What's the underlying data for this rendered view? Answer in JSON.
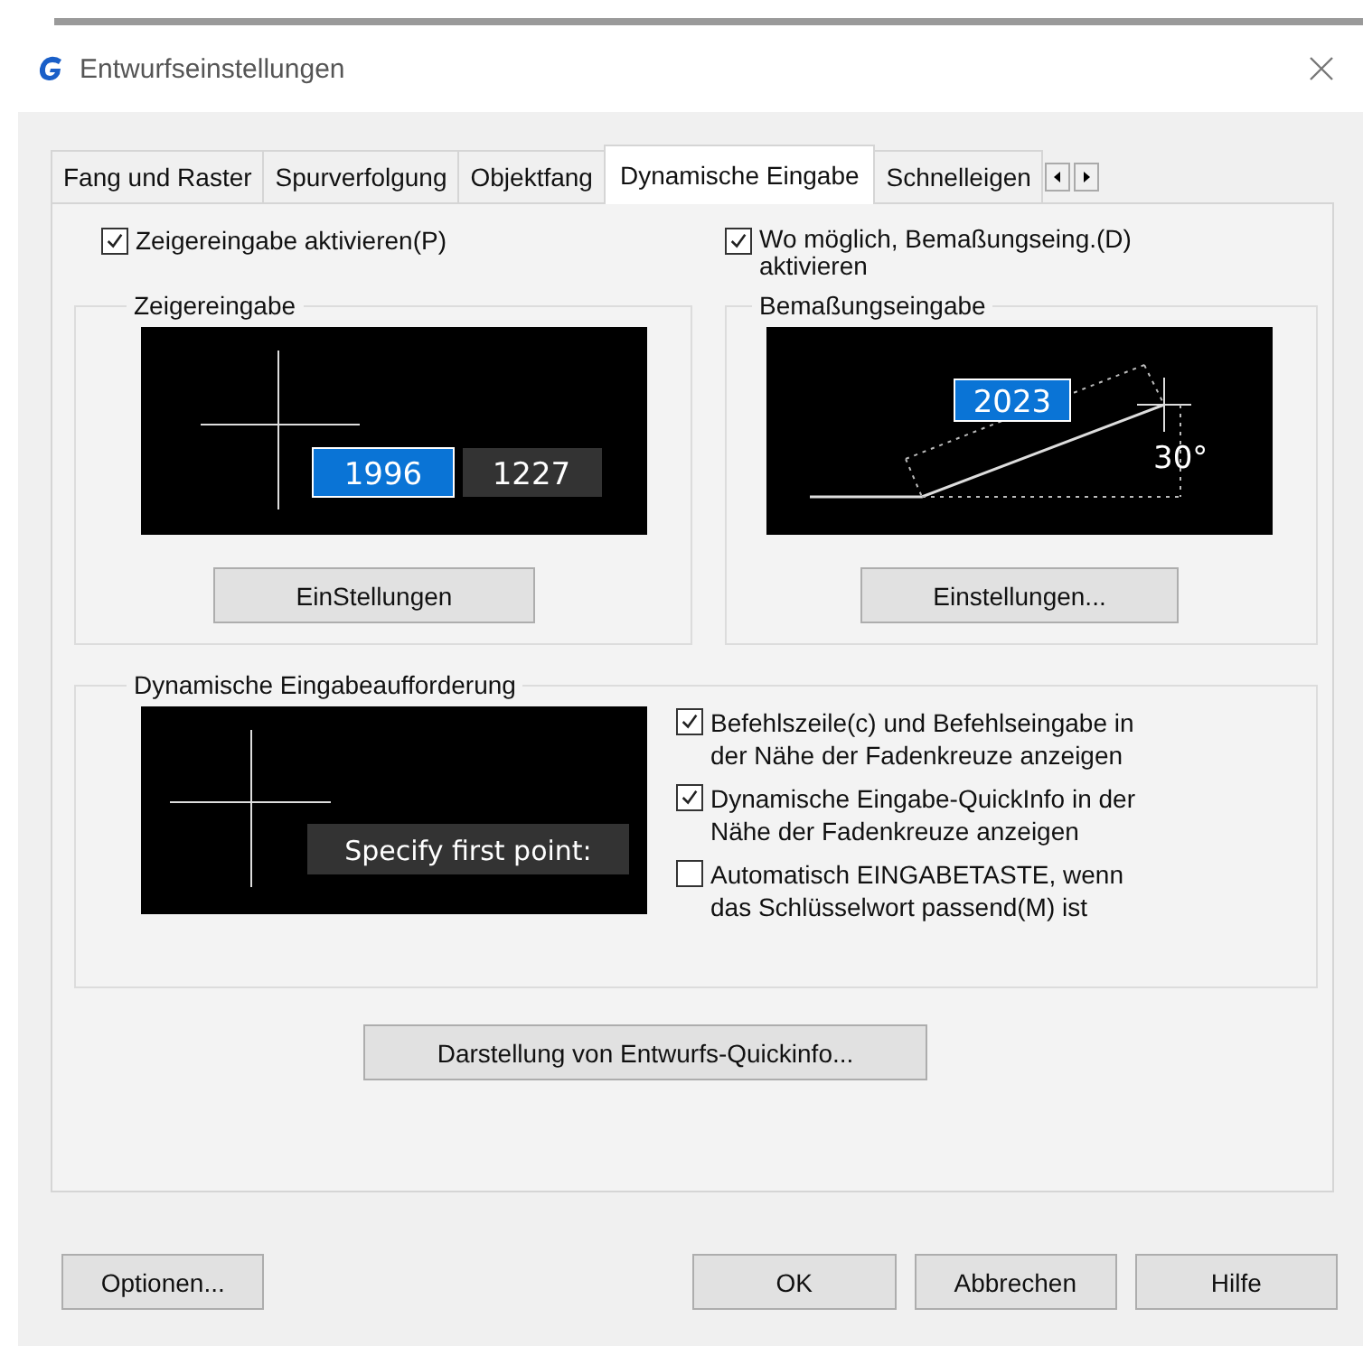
{
  "window": {
    "title": "Entwurfseinstellungen"
  },
  "tabs": [
    {
      "label": "Fang und Raster",
      "selected": false
    },
    {
      "label": "Spurverfolgung",
      "selected": false
    },
    {
      "label": "Objektfang",
      "selected": false
    },
    {
      "label": "Dynamische Eingabe",
      "selected": true
    },
    {
      "label": "Schnelleigen",
      "selected": false
    }
  ],
  "pointer_input": {
    "checkbox": {
      "label": "Zeigereingabe aktivieren(P)",
      "checked": true
    },
    "group_title": "Zeigereingabe",
    "preview": {
      "x_value": "1996",
      "y_value": "1227"
    },
    "button": "EinStellungen"
  },
  "dimension_input": {
    "checkbox": {
      "label": "Wo möglich, Bemaßungseing.(D) aktivieren",
      "checked": true
    },
    "group_title": "Bemaßungseingabe",
    "preview": {
      "length": "2023",
      "angle": "30°"
    },
    "button": "Einstellungen..."
  },
  "dynamic_prompt": {
    "group_title": "Dynamische Eingabeaufforderung",
    "preview": {
      "prompt": "Specify first point:"
    },
    "options": [
      {
        "label": "Befehlszeile(c) und Befehlseingabe in der Nähe der Fadenkreuze anzeigen",
        "checked": true
      },
      {
        "label": "Dynamische Eingabe-QuickInfo in der Nähe der Fadenkreuze anzeigen",
        "checked": true
      },
      {
        "label": "Automatisch EINGABETASTE, wenn das Schlüsselwort passend(M) ist",
        "checked": false
      }
    ]
  },
  "appearance_button": "Darstellung von Entwurfs-Quickinfo...",
  "buttons": [
    "Optionen...",
    "OK",
    "Abbrechen",
    "Hilfe"
  ]
}
